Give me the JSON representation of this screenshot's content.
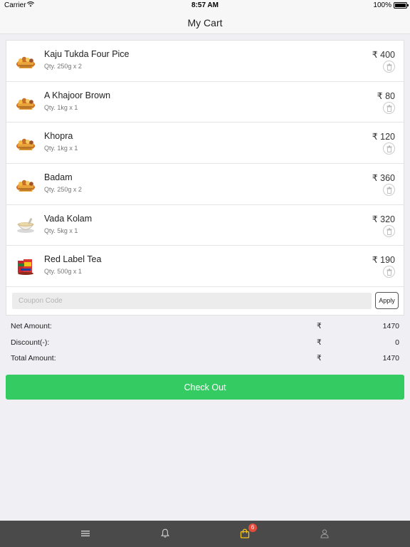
{
  "status_bar": {
    "carrier": "Carrier",
    "time": "8:57 AM",
    "battery": "100%"
  },
  "header": {
    "title": "My Cart"
  },
  "cart": {
    "items": [
      {
        "name": "Kaju Tukda Four Pice",
        "qty": "Qty. 250g x 2",
        "price": "₹ 400",
        "image_icon": "dry-fruit-basket-icon"
      },
      {
        "name": "A Khajoor Brown",
        "qty": "Qty. 1kg x 1",
        "price": "₹ 80",
        "image_icon": "dry-fruit-basket-icon"
      },
      {
        "name": "Khopra",
        "qty": "Qty. 1kg x 1",
        "price": "₹ 120",
        "image_icon": "dry-fruit-basket-icon"
      },
      {
        "name": "Badam",
        "qty": "Qty. 250g x 2",
        "price": "₹ 360",
        "image_icon": "dry-fruit-basket-icon"
      },
      {
        "name": "Vada Kolam",
        "qty": "Qty. 5kg x 1",
        "price": "₹ 320",
        "image_icon": "rice-bowl-icon"
      },
      {
        "name": "Red Label Tea",
        "qty": "Qty. 500g x 1",
        "price": "₹ 190",
        "image_icon": "tea-pack-icon"
      }
    ]
  },
  "coupon": {
    "placeholder": "Coupon Code",
    "value": "",
    "apply_label": "Apply"
  },
  "summary": {
    "currency_symbol": "₹",
    "rows": [
      {
        "label": "Net Amount:",
        "value": "1470"
      },
      {
        "label": "Discount(-):",
        "value": "0"
      },
      {
        "label": "Total Amount:",
        "value": "1470"
      }
    ]
  },
  "checkout": {
    "label": "Check Out"
  },
  "tab_bar": {
    "cart_badge": "6",
    "icons": [
      "menu-icon",
      "bell-icon",
      "shopping-bag-icon",
      "user-icon"
    ]
  },
  "colors": {
    "checkout_green": "#34cb62",
    "tab_bar_bg": "#4a4a4a",
    "active_tab_yellow": "#f5c518",
    "badge_red": "#e64a3b",
    "page_bg": "#efeff4"
  }
}
